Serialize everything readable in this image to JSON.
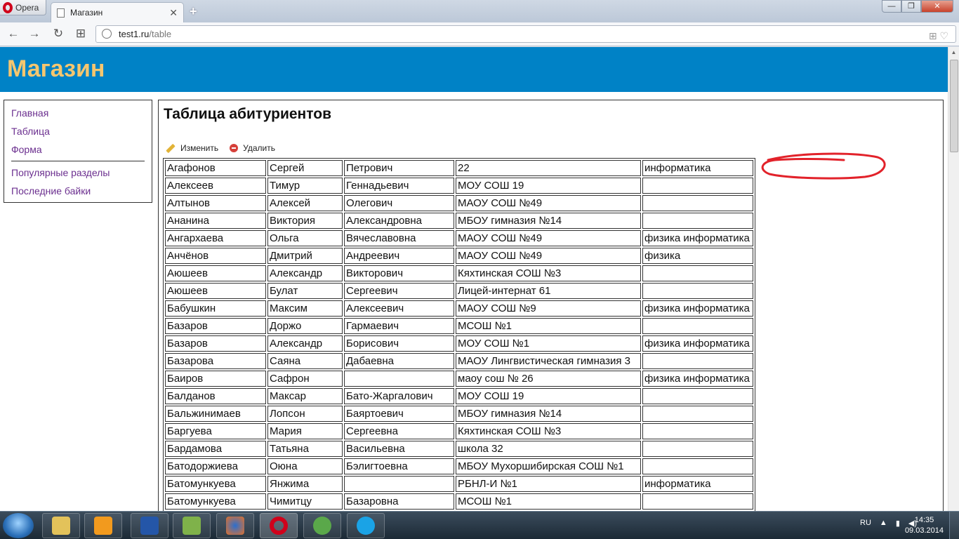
{
  "browser": {
    "menu_label": "Opera",
    "tab_title": "Магазин",
    "tab_close": "✕",
    "new_tab": "+",
    "url_host": "test1.ru",
    "url_path": "/table",
    "buttons": {
      "back": "←",
      "forward": "→",
      "reload": "↻",
      "speed_dial": "⊞",
      "minimize": "—",
      "maximize": "❐",
      "close": "✕"
    }
  },
  "site": {
    "title": "Магазин"
  },
  "sidebar": {
    "items": [
      "Главная",
      "Таблица",
      "Форма"
    ],
    "items2": [
      "Популярные разделы",
      "Последние байки"
    ]
  },
  "main": {
    "heading": "Таблица абитуриентов",
    "edit_label": "Изменить",
    "delete_label": "Удалить"
  },
  "table": {
    "rows": [
      [
        "Агафонов",
        "Сергей",
        "Петрович",
        "22",
        "информатика"
      ],
      [
        "Алексеев",
        "Тимур",
        "Геннадьевич",
        "МОУ СОШ 19",
        ""
      ],
      [
        "Алтынов",
        "Алексей",
        "Олегович",
        "МАОУ СОШ №49",
        ""
      ],
      [
        "Ананина",
        "Виктория",
        "Александровна",
        "МБОУ гимназия №14",
        ""
      ],
      [
        "Ангархаева",
        "Ольга",
        "Вячеславовна",
        "МАОУ СОШ №49",
        "физика информатика"
      ],
      [
        "Анчёнов",
        "Дмитрий",
        "Андреевич",
        "МАОУ СОШ №49",
        "физика"
      ],
      [
        "Аюшеев",
        "Александр",
        "Викторович",
        "Кяхтинская СОШ №3",
        ""
      ],
      [
        "Аюшеев",
        "Булат",
        "Сергеевич",
        "Лицей-интернат 61",
        ""
      ],
      [
        "Бабушкин",
        "Максим",
        "Алексеевич",
        "МАОУ СОШ №9",
        "физика информатика"
      ],
      [
        "Базаров",
        "Доржо",
        "Гармаевич",
        "МСОШ №1",
        ""
      ],
      [
        "Базаров",
        "Александр",
        "Борисович",
        "МОУ СОШ №1",
        "физика информатика"
      ],
      [
        "Базарова",
        "Саяна",
        "Дабаевна",
        "МАОУ Лингвистическая гимназия  3",
        ""
      ],
      [
        "Баиров",
        "Сафрон",
        "",
        "маоу сош № 26",
        "физика информатика"
      ],
      [
        "Балданов",
        "Максар",
        "Бато-Жаргалович",
        "МОУ СОШ 19",
        ""
      ],
      [
        "Бальжинимаев",
        "Лопсон",
        "Баяртоевич",
        "МБОУ гимназия №14",
        ""
      ],
      [
        "Баргуева",
        "Мария",
        "Сергеевна",
        "Кяхтинская СОШ №3",
        ""
      ],
      [
        "Бардамова",
        "Татьяна",
        "Васильевна",
        "школа 32",
        ""
      ],
      [
        "Батодоржиева",
        "Оюна",
        "Бэлигтоевна",
        "МБОУ Мухоршибирская СОШ №1",
        ""
      ],
      [
        "Батомункуева",
        "Янжима",
        "",
        "РБНЛ-И №1",
        "информатика"
      ],
      [
        "Батомункуева",
        "Чимитцу",
        "Базаровна",
        "МСОШ №1",
        ""
      ]
    ]
  },
  "taskbar": {
    "apps": [
      "explorer-icon",
      "media-player-icon",
      "save-disk-icon",
      "notes-icon",
      "firefox-icon",
      "opera-icon",
      "utorrent-icon",
      "skype-icon"
    ],
    "lang": "RU",
    "time": "14:35",
    "date": "09.03.2014"
  }
}
